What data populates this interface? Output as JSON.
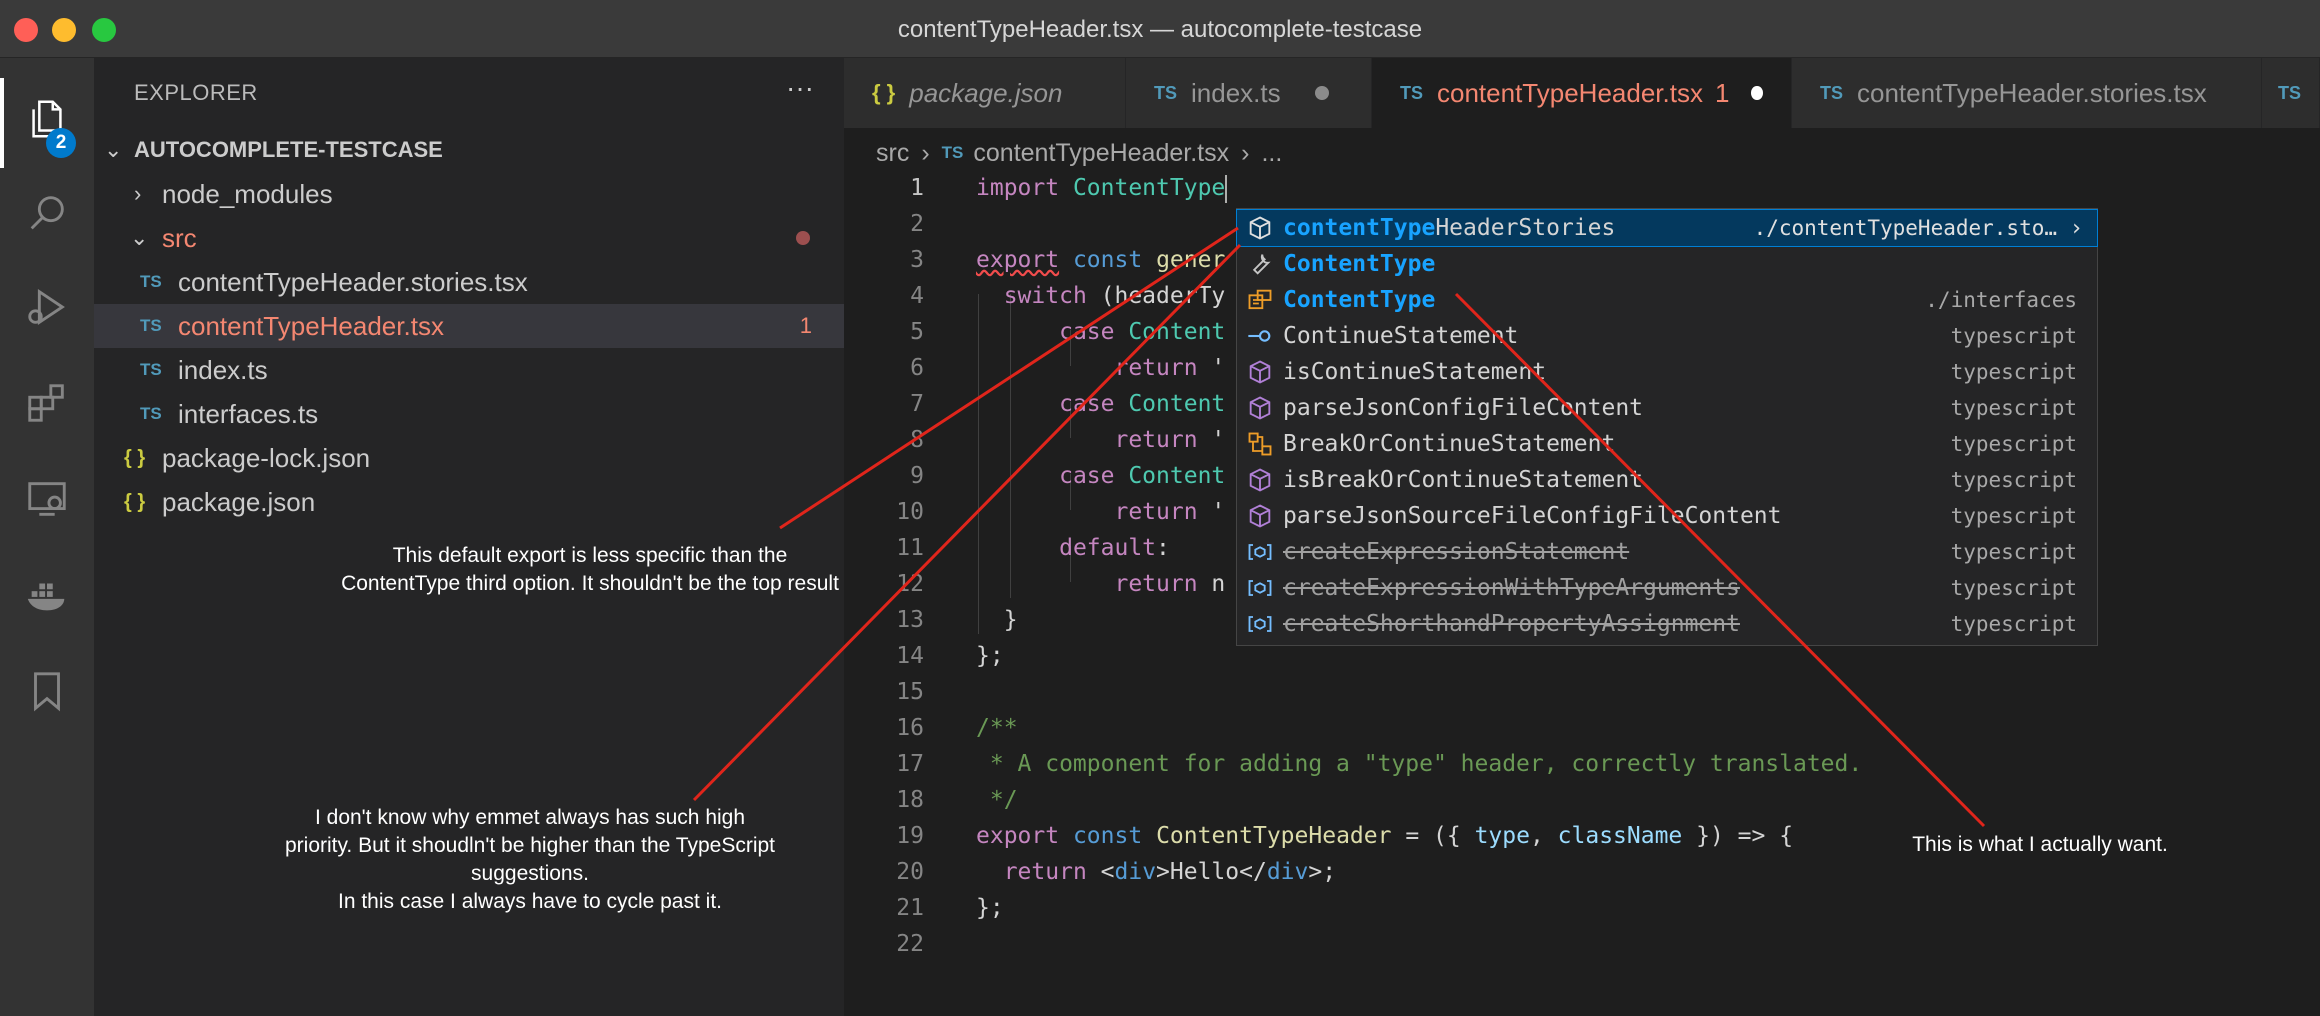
{
  "window": {
    "title": "contentTypeHeader.tsx — autocomplete-testcase"
  },
  "activity_bar": {
    "badge": "2",
    "items": [
      "files-icon",
      "search-icon",
      "run-debug-icon",
      "extensions-icon",
      "remote-explorer-icon",
      "docker-icon",
      "bookmark-icon"
    ]
  },
  "sidebar": {
    "header": "EXPLORER",
    "more": "···",
    "root": "AUTOCOMPLETE-TESTCASE",
    "items": [
      {
        "label": "node_modules"
      },
      {
        "label": "src"
      },
      {
        "icon": "TS",
        "label": "contentTypeHeader.stories.tsx"
      },
      {
        "icon": "TS",
        "label": "contentTypeHeader.tsx",
        "count": "1"
      },
      {
        "icon": "TS",
        "label": "index.ts"
      },
      {
        "icon": "TS",
        "label": "interfaces.ts"
      },
      {
        "icon": "{ }",
        "label": "package-lock.json"
      },
      {
        "icon": "{ }",
        "label": "package.json"
      }
    ]
  },
  "tabs": [
    {
      "icon": "{ }",
      "label": "package.json"
    },
    {
      "icon": "TS",
      "label": "index.ts"
    },
    {
      "icon": "TS",
      "label": "contentTypeHeader.tsx",
      "count": "1"
    },
    {
      "icon": "TS",
      "label": "contentTypeHeader.stories.tsx"
    },
    {
      "icon": "TS"
    }
  ],
  "breadcrumb": {
    "folder": "src",
    "icon": "TS",
    "file": "contentTypeHeader.tsx",
    "more": "..."
  },
  "code": {
    "lines": [
      {
        "n": "1",
        "kw": "import",
        "rest": " ContentType"
      },
      {
        "n": "2"
      },
      {
        "n": "3",
        "kw": "export",
        "kw2": "const",
        "rest": "gener"
      },
      {
        "n": "4",
        "kw": "switch",
        "rest": " (headerTy"
      },
      {
        "n": "5",
        "kw": "case",
        "rest": " Content"
      },
      {
        "n": "6",
        "kw": "return",
        "rest": " '"
      },
      {
        "n": "7",
        "kw": "case",
        "rest": " Content"
      },
      {
        "n": "8",
        "kw": "return",
        "rest": " '"
      },
      {
        "n": "9",
        "kw": "case",
        "rest": " Content"
      },
      {
        "n": "10",
        "kw": "return",
        "rest": " '"
      },
      {
        "n": "11",
        "kw": "default",
        "rest": ":"
      },
      {
        "n": "12",
        "kw": "return",
        "rest": " n"
      },
      {
        "n": "13",
        "rest": "}"
      },
      {
        "n": "14",
        "rest": "};"
      },
      {
        "n": "15"
      },
      {
        "n": "16",
        "comment": "/**"
      },
      {
        "n": "17",
        "comment": " * A component for adding a \"type\" header, correctly translated."
      },
      {
        "n": "18",
        "comment": " */"
      },
      {
        "n": "19",
        "kw": "export",
        "kw2": "const",
        "name": "ContentTypeHeader",
        "p1": " = ({ ",
        "arg1": "type",
        "p2": ", ",
        "arg2": "className",
        "p3": " }) => {"
      },
      {
        "n": "20",
        "kw": "return",
        "p1": " <",
        "tag": "div",
        "p2": ">Hello</",
        "tag2": "div",
        "p3": ">;"
      },
      {
        "n": "21",
        "rest": "};"
      },
      {
        "n": "22"
      }
    ]
  },
  "suggestions": [
    {
      "icon": "module-icon",
      "match": "contentType",
      "rest": "HeaderStories",
      "detail": "./contentTypeHeader.sto…",
      "selected": true
    },
    {
      "icon": "wrench-icon",
      "match": "ContentType",
      "rest": "",
      "detail": ""
    },
    {
      "icon": "enum-icon",
      "match": "ContentType",
      "rest": "",
      "detail": "./interfaces"
    },
    {
      "icon": "interface-icon",
      "match": "",
      "rest": "ContinueStatement",
      "detail": "typescript"
    },
    {
      "icon": "method-icon",
      "match": "",
      "rest": "isContinueStatement",
      "detail": "typescript"
    },
    {
      "icon": "method-icon",
      "match": "",
      "rest": "parseJsonConfigFileContent",
      "detail": "typescript"
    },
    {
      "icon": "class-icon",
      "match": "",
      "rest": "BreakOrContinueStatement",
      "detail": "typescript"
    },
    {
      "icon": "method-icon",
      "match": "",
      "rest": "isBreakOrContinueStatement",
      "detail": "typescript"
    },
    {
      "icon": "method-icon",
      "match": "",
      "rest": "parseJsonSourceFileConfigFileContent",
      "detail": "typescript"
    },
    {
      "icon": "variable-icon",
      "match": "",
      "rest": "createExpressionStatement",
      "detail": "typescript",
      "deprecated": true
    },
    {
      "icon": "variable-icon",
      "match": "",
      "rest": "createExpressionWithTypeArguments",
      "detail": "typescript",
      "deprecated": true
    },
    {
      "icon": "variable-icon",
      "match": "",
      "rest": "createShorthandPropertyAssignment",
      "detail": "typescript",
      "deprecated": true
    }
  ],
  "annotations": {
    "default_export": "This default export is less specific than the ContentType third option. It shouldn't be the top result",
    "emmet": [
      "I don't know why emmet always has such high priority. But it shoudln't be higher than the TypeScript suggestions.",
      "In this case I always have to cycle past it."
    ],
    "want": "This is what I actually want."
  },
  "colors": {
    "accent": "#007acc",
    "error": "#f48771",
    "selection": "#04395e",
    "arrow": "#e0251b"
  }
}
